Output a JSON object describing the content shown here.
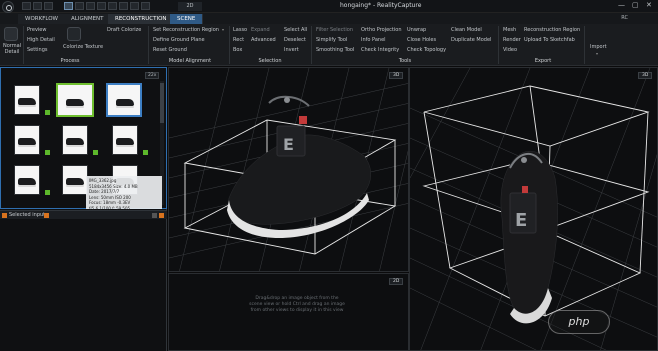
{
  "app": {
    "title": "hongaing* - RealityCapture",
    "mode_2d": "2D",
    "user_initials": "RC",
    "window_controls": [
      "—",
      "▢",
      "✕"
    ]
  },
  "tabs": [
    {
      "label": "WORKFLOW",
      "active": false
    },
    {
      "label": "ALIGNMENT",
      "active": false
    },
    {
      "label": "RECONSTRUCTION",
      "active": true
    },
    {
      "label": "SCENE",
      "active": false
    }
  ],
  "ribbon": {
    "normal_detail": "Normal Detail",
    "process": {
      "preview": "Preview",
      "high_detail": "High Detail",
      "settings": "Settings",
      "colorize_texture": "Colorize Texture",
      "draft_colorize": "Draft Colorize",
      "label": "Process"
    },
    "model_alignment": {
      "set_region": "Set Reconstruction Region",
      "define_ground": "Define Ground Plane",
      "reset_ground": "Reset Ground",
      "label": "Model Alignment"
    },
    "selection": {
      "lasso": "Lasso",
      "rect": "Rect",
      "box": "Box",
      "expand": "Expand",
      "advanced": "Advanced",
      "select_all": "Select All",
      "deselect": "Deselect",
      "invert": "Invert",
      "label": "Selection"
    },
    "tools": {
      "filter_selection": "Filter Selection",
      "simplify_tool": "Simplify Tool",
      "smoothing_tool": "Smoothing Tool",
      "ortho_projection": "Ortho Projection",
      "info_panel": "Info Panel",
      "check_integrity": "Check Integrity",
      "unwrap": "Unwrap",
      "close_holes": "Close Holes",
      "check_topology": "Check Topology",
      "clean_model": "Clean Model",
      "duplicate_model": "Duplicate Model",
      "label": "Tools"
    },
    "export": {
      "mesh": "Mesh",
      "render": "Render",
      "video": "Video",
      "reconstruction_region": "Reconstruction Region",
      "upload_sketchfab": "Upload To Sketchfab",
      "label": "Export"
    },
    "import": "Import"
  },
  "left_panel": {
    "thumb_count": "22x",
    "tooltip": [
      "IMG_3362.jpg",
      "5184x3456  Size: 4.0 MB",
      "Date: 2017/7/7",
      "Lens: 50mm  ISO 200",
      "Focus: 18mm  -0.3EV",
      "f/5.6  1/100  f: 59.505"
    ],
    "selected_input": "Selected input"
  },
  "viewports": {
    "vp1_badge": "3D",
    "vp2_badge": "3D",
    "vp3_badge": "2D",
    "vp3_hint": "Drag&drop an image object from the scene view or hold Ctrl and drag an image from other views to display it in this view"
  },
  "watermark": "php",
  "colors": {
    "tab_active": "#2f5a86",
    "selection_green": "#6fbf2f",
    "focus_blue": "#3d7fc4",
    "accent_orange": "#d9731e",
    "shoe_red": "#c23a3a"
  }
}
